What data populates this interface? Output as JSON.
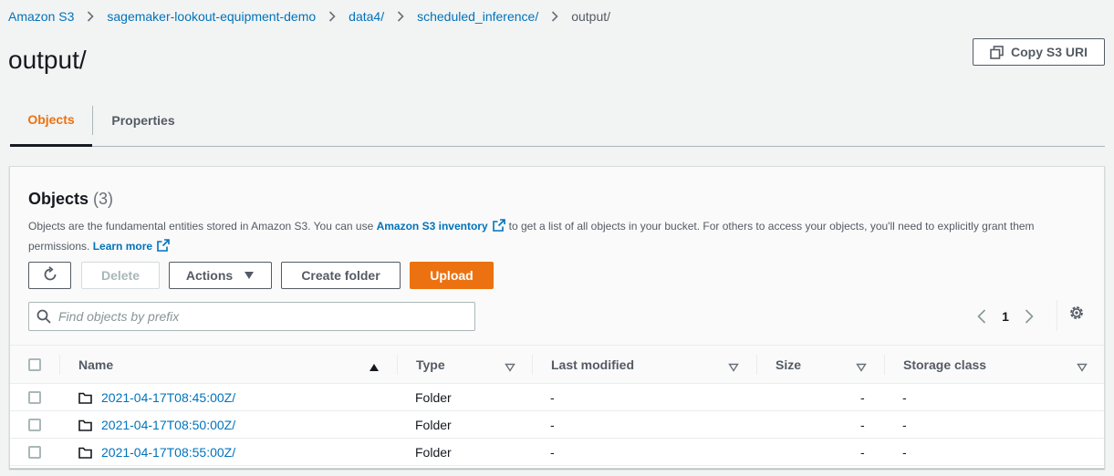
{
  "breadcrumb": {
    "items": [
      "Amazon S3",
      "sagemaker-lookout-equipment-demo",
      "data4/",
      "scheduled_inference/"
    ],
    "current": "output/"
  },
  "page": {
    "title": "output/"
  },
  "copy_button": {
    "label": "Copy S3 URI",
    "icon": "copy-icon"
  },
  "tabs": [
    {
      "label": "Objects",
      "active": true
    },
    {
      "label": "Properties",
      "active": false
    }
  ],
  "panel": {
    "title": "Objects",
    "count": "(3)",
    "description_pre": "Objects are the fundamental entities stored in Amazon S3. You can use",
    "inventory_link": "Amazon S3 inventory",
    "description_mid": "to get a list of all objects in your bucket. For others to access your objects, you'll need to explicitly grant them permissions.",
    "learn_more": "Learn more"
  },
  "toolbar": {
    "refresh_icon": "refresh-icon",
    "delete_label": "Delete",
    "actions_label": "Actions",
    "create_folder_label": "Create folder",
    "upload_label": "Upload"
  },
  "search": {
    "placeholder": "Find objects by prefix",
    "value": ""
  },
  "pagination": {
    "current_page": "1"
  },
  "colors": {
    "accent": "#ec7211",
    "link": "#0073bb"
  },
  "table": {
    "columns": [
      "Name",
      "Type",
      "Last modified",
      "Size",
      "Storage class"
    ],
    "rows": [
      {
        "name": "2021-04-17T08:45:00Z/",
        "type": "Folder",
        "last_modified": "-",
        "size": "-",
        "storage_class": "-"
      },
      {
        "name": "2021-04-17T08:50:00Z/",
        "type": "Folder",
        "last_modified": "-",
        "size": "-",
        "storage_class": "-"
      },
      {
        "name": "2021-04-17T08:55:00Z/",
        "type": "Folder",
        "last_modified": "-",
        "size": "-",
        "storage_class": "-"
      }
    ]
  }
}
